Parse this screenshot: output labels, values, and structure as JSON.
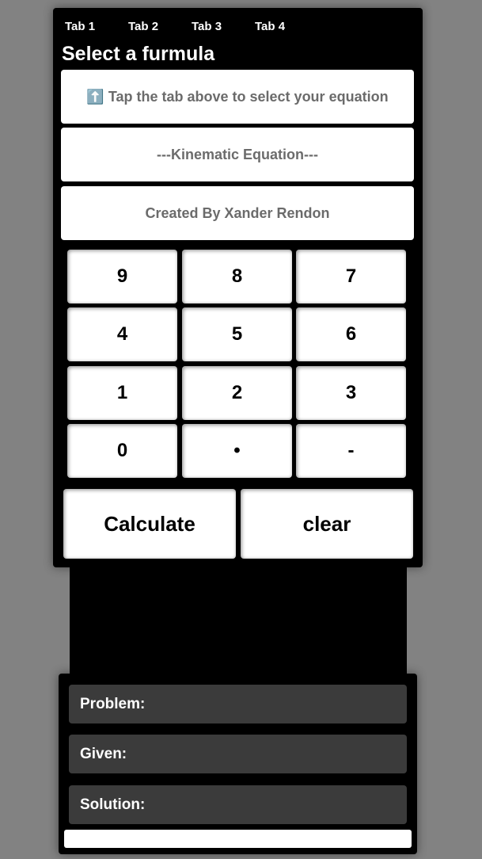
{
  "tabs": [
    {
      "label": "Tab 1"
    },
    {
      "label": "Tab 2"
    },
    {
      "label": "Tab 3"
    },
    {
      "label": "Tab 4"
    }
  ],
  "header": {
    "title": "Select a furmula"
  },
  "info_boxes": {
    "hint": "⬆️ Tap the tab above to select your equation",
    "equation": "---Kinematic Equation---",
    "credit": "Created By Xander Rendon"
  },
  "keypad": {
    "keys": [
      "9",
      "8",
      "7",
      "4",
      "5",
      "6",
      "1",
      "2",
      "3",
      "0",
      "•",
      "-"
    ]
  },
  "actions": {
    "calculate_label": "Calculate",
    "clear_label": "clear"
  },
  "output": {
    "problem_label": "Problem:",
    "given_label": "Given:",
    "solution_label": "Solution:"
  }
}
